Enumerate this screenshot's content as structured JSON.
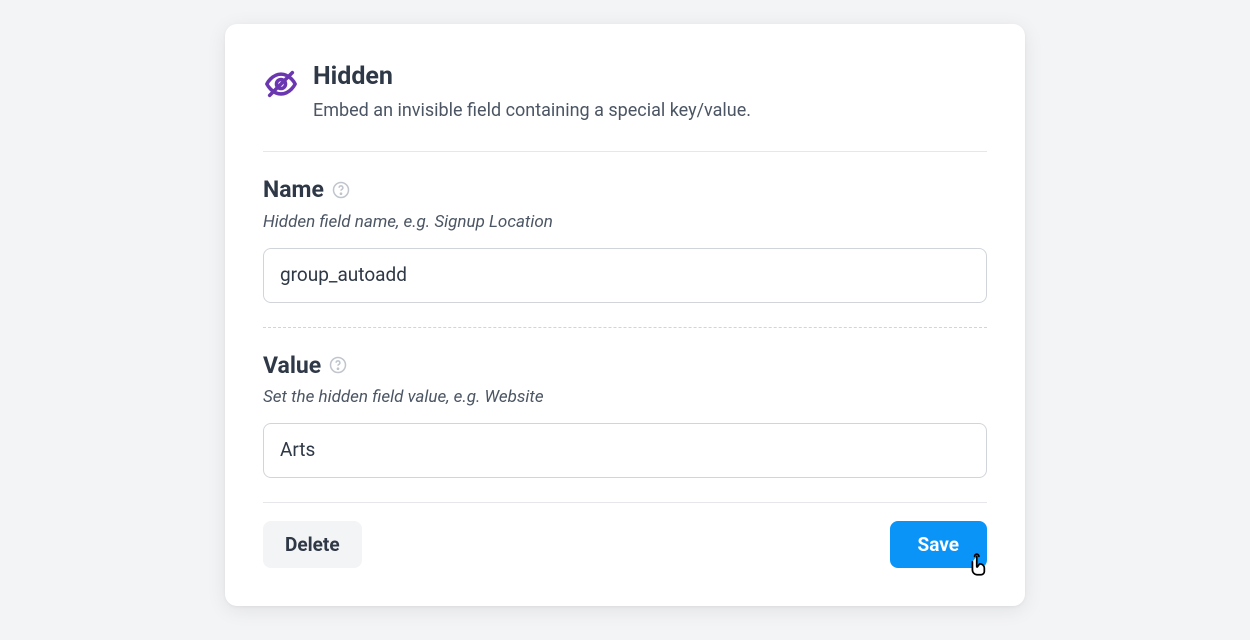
{
  "header": {
    "title": "Hidden",
    "subtitle": "Embed an invisible field containing a special key/value."
  },
  "fields": {
    "name": {
      "label": "Name",
      "hint": "Hidden field name, e.g. Signup Location",
      "value": "group_autoadd"
    },
    "value": {
      "label": "Value",
      "hint": "Set the hidden field value, e.g. Website",
      "value": "Arts"
    }
  },
  "footer": {
    "delete_label": "Delete",
    "save_label": "Save"
  }
}
